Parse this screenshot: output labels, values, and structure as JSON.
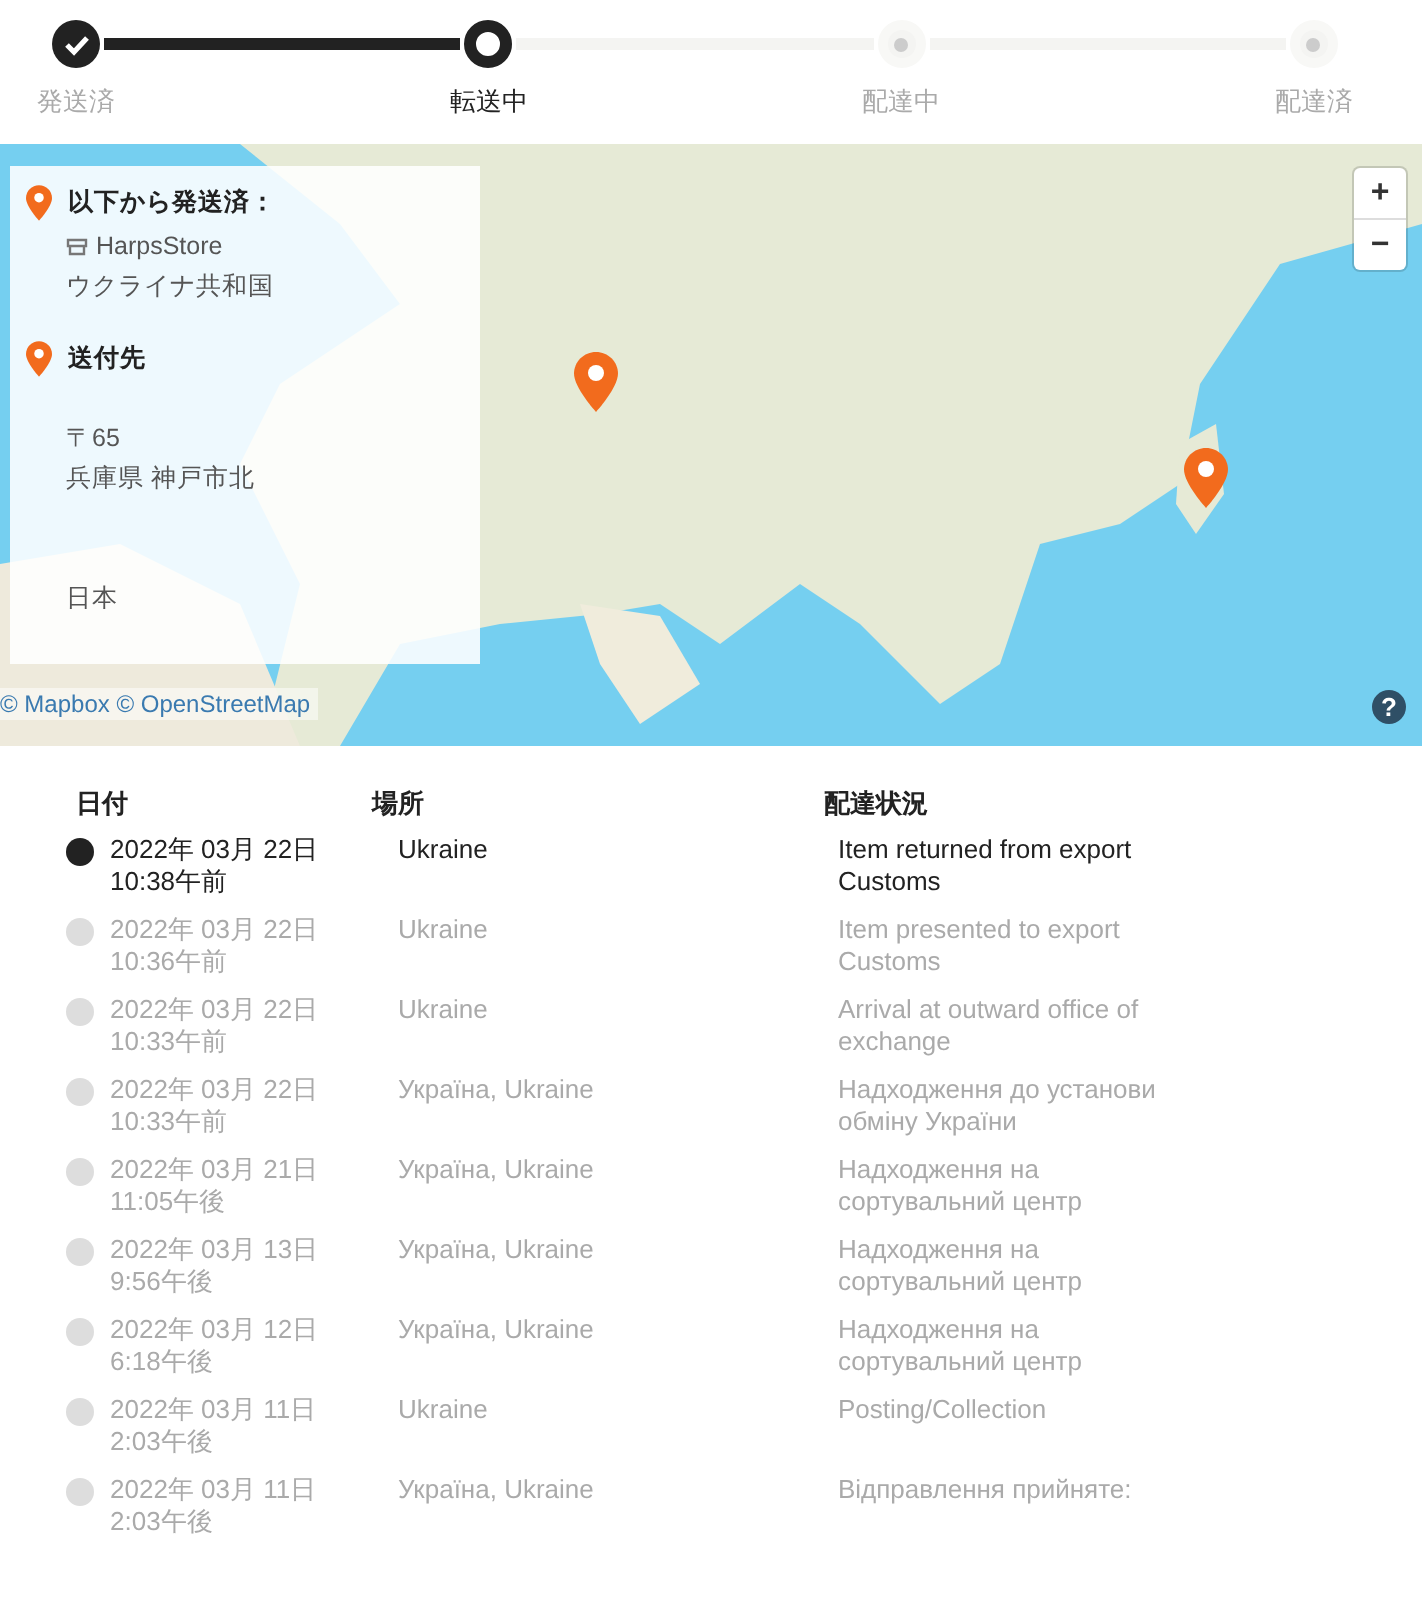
{
  "steps": [
    {
      "label": "発送済",
      "done": true,
      "selected": false
    },
    {
      "label": "転送中",
      "done": false,
      "selected": true
    },
    {
      "label": "配達中",
      "done": false,
      "selected": false
    },
    {
      "label": "配達済",
      "done": false,
      "selected": false
    }
  ],
  "map": {
    "origin": {
      "heading": "以下から発送済：",
      "store": "HarpsStore",
      "country": "ウクライナ共和国"
    },
    "destination": {
      "heading": "送付先",
      "lines": [
        "〒65",
        "兵庫県 神戸市北",
        "日本"
      ]
    },
    "zoom_in": "+",
    "zoom_out": "−",
    "attribution": "© Mapbox © OpenStreetMap",
    "help": "?"
  },
  "table": {
    "columns": [
      "日付",
      "場所",
      "配達状況"
    ],
    "rows": [
      {
        "date": "2022年 03月 22日",
        "time": "10:38午前",
        "location": "Ukraine",
        "status": "Item returned from export Customs",
        "current": true
      },
      {
        "date": "2022年 03月 22日",
        "time": "10:36午前",
        "location": "Ukraine",
        "status": "Item presented to export Customs",
        "current": false
      },
      {
        "date": "2022年 03月 22日",
        "time": "10:33午前",
        "location": "Ukraine",
        "status": "Arrival at outward office of exchange",
        "current": false
      },
      {
        "date": "2022年 03月 22日",
        "time": "10:33午前",
        "location": "Україна, Ukraine",
        "status": "Надходження до установи обміну України",
        "current": false
      },
      {
        "date": "2022年 03月 21日",
        "time": "11:05午後",
        "location": "Україна, Ukraine",
        "status": "Надходження на сортувальний центр",
        "current": false
      },
      {
        "date": "2022年 03月 13日",
        "time": "9:56午後",
        "location": "Україна, Ukraine",
        "status": "Надходження на сортувальний центр",
        "current": false
      },
      {
        "date": "2022年 03月 12日",
        "time": "6:18午後",
        "location": "Україна, Ukraine",
        "status": "Надходження на сортувальний центр",
        "current": false
      },
      {
        "date": "2022年 03月 11日",
        "time": "2:03午後",
        "location": "Ukraine",
        "status": "Posting/Collection",
        "current": false
      },
      {
        "date": "2022年 03月 11日",
        "time": "2:03午後",
        "location": "Україна, Ukraine",
        "status": "Відправлення прийняте:",
        "current": false
      }
    ]
  }
}
